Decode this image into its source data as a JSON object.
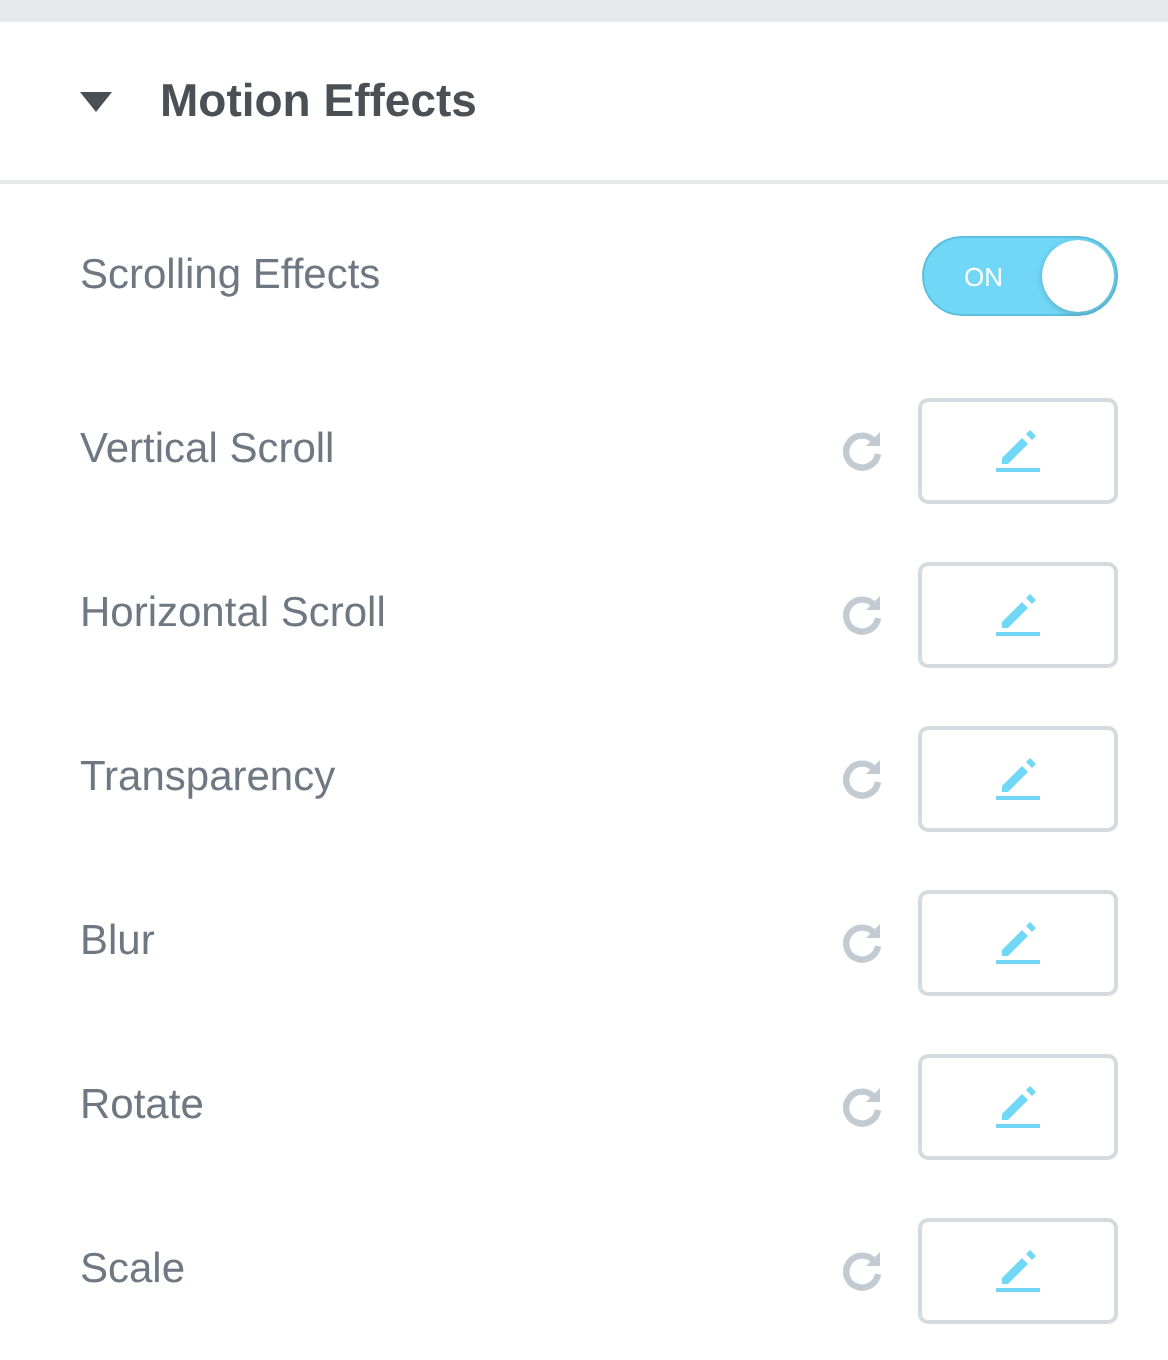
{
  "section": {
    "title": "Motion Effects",
    "expanded": true
  },
  "switch": {
    "label": "Scrolling Effects",
    "on": true,
    "text": "ON"
  },
  "effects": [
    {
      "label": "Vertical Scroll"
    },
    {
      "label": "Horizontal Scroll"
    },
    {
      "label": "Transparency"
    },
    {
      "label": "Blur"
    },
    {
      "label": "Rotate"
    },
    {
      "label": "Scale"
    }
  ]
}
